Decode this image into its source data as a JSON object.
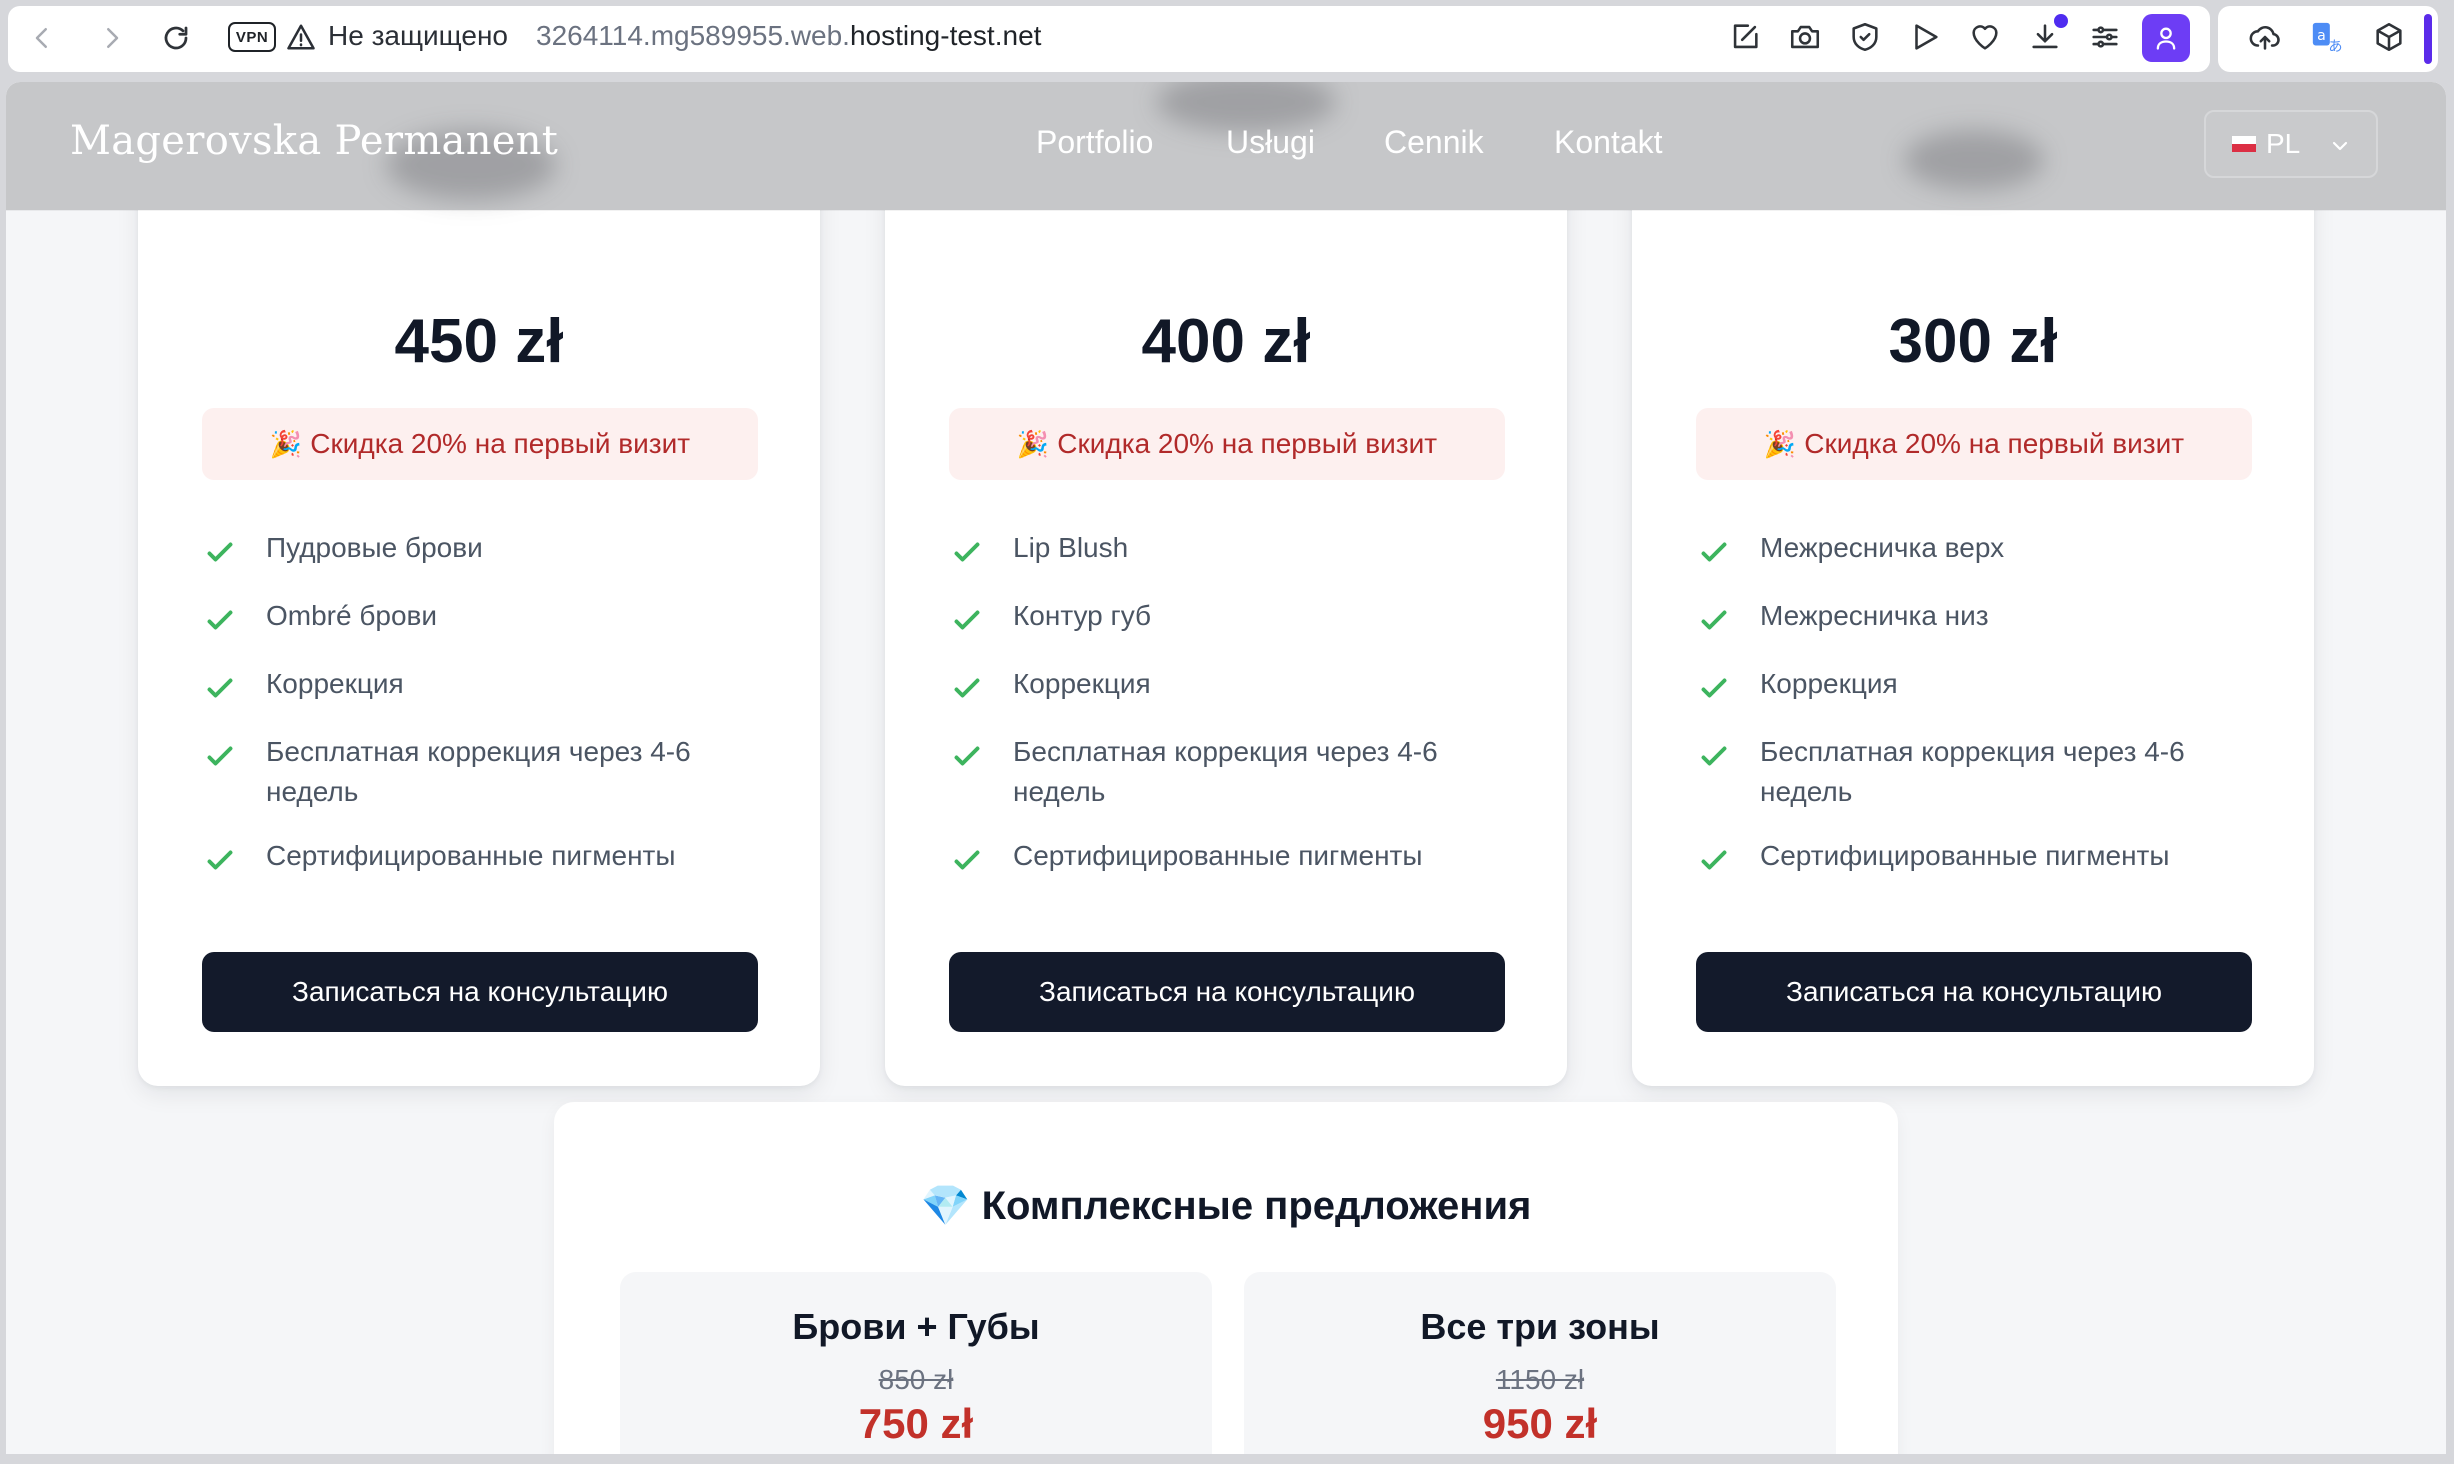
{
  "browser": {
    "vpn_label": "VPN",
    "security_label": "Не защищено",
    "url_prefix": "3264114.mg589955.web.",
    "url_domain": "hosting-test.net"
  },
  "site": {
    "logo": "Magerovska Permanent",
    "nav": [
      "Portfolio",
      "Usługi",
      "Cennik",
      "Kontakt"
    ],
    "language": "PL"
  },
  "cards": [
    {
      "price": "450 zł",
      "promo": "Скидка 20% на первый визит",
      "features": [
        "Пудровые брови",
        "Ombré брови",
        "Коррекция",
        "Бесплатная коррекция через 4-6 недель",
        "Сертифицированные пигменты"
      ],
      "cta": "Записаться на консультацию"
    },
    {
      "price": "400 zł",
      "promo": "Скидка 20% на первый визит",
      "features": [
        "Lip Blush",
        "Контур губ",
        "Коррекция",
        "Бесплатная коррекция через 4-6 недель",
        "Сертифицированные пигменты"
      ],
      "cta": "Записаться на консультацию"
    },
    {
      "price": "300 zł",
      "promo": "Скидка 20% на первый визит",
      "features": [
        "Межресничка верх",
        "Межресничка низ",
        "Коррекция",
        "Бесплатная коррекция через 4-6 недель",
        "Сертифицированные пигменты"
      ],
      "cta": "Записаться на консультацию"
    }
  ],
  "bundles": {
    "title": "Комплексные предложения",
    "items": [
      {
        "name": "Брови + Губы",
        "old_price": "850 zł",
        "new_price": "750 zł"
      },
      {
        "name": "Все три зоны",
        "old_price": "1150 zł",
        "new_price": "950 zł"
      }
    ]
  },
  "colors": {
    "cta_bg": "#131a2b",
    "promo_bg": "#fdf0ef",
    "promo_text": "#b12a2a",
    "check": "#3db45e",
    "sale_price": "#c2312a",
    "profile_accent": "#6d3df5"
  },
  "icons": {
    "toolbar": [
      "edit-icon",
      "camera-icon",
      "shield-icon",
      "play-icon",
      "heart-icon",
      "download-icon",
      "menu-sliders-icon",
      "profile-icon"
    ],
    "side": [
      "cloud-upload-icon",
      "translate-icon",
      "cube-icon"
    ],
    "promo_emoji": "🎉",
    "bundle_emoji": "💎"
  }
}
